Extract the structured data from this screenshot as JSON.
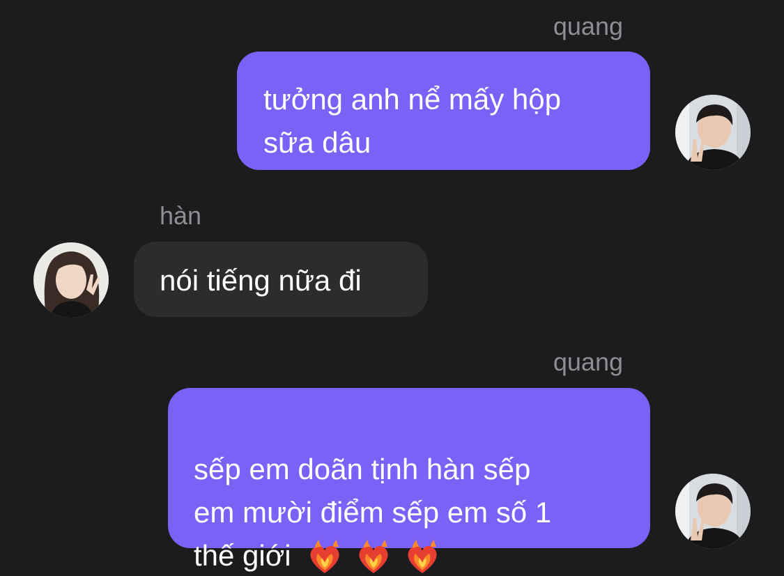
{
  "messages": [
    {
      "sender": "quang",
      "direction": "outgoing",
      "text": "tưởng anh nể mấy hộp\nsữa dâu",
      "avatar": "quang-avatar"
    },
    {
      "sender": "hàn",
      "direction": "incoming",
      "text": "nói tiếng nữa đi",
      "avatar": "han-avatar"
    },
    {
      "sender": "quang",
      "direction": "outgoing",
      "text": "sếp em doãn tịnh hàn sếp\nem mười điểm sếp em số 1\nthế giới",
      "emoji": [
        "heart-on-fire-icon",
        "heart-on-fire-icon",
        "heart-on-fire-icon"
      ],
      "avatar": "quang-avatar"
    }
  ],
  "colors": {
    "background": "#1c1c1e",
    "outgoing_bubble": "#7b61f5",
    "incoming_bubble": "#2c2c2e",
    "sender_label": "#8e8e93",
    "text": "#ffffff"
  }
}
